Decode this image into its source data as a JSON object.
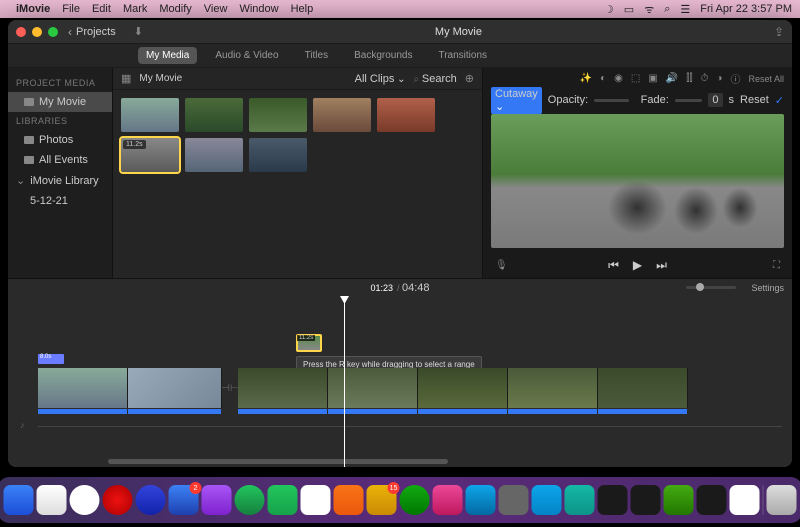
{
  "menubar": {
    "app": "iMovie",
    "items": [
      "File",
      "Edit",
      "Mark",
      "Modify",
      "View",
      "Window",
      "Help"
    ],
    "clock": "Fri Apr 22  3:57 PM"
  },
  "titlebar": {
    "projects": "Projects",
    "title": "My Movie"
  },
  "tabs": [
    "My Media",
    "Audio & Video",
    "Titles",
    "Backgrounds",
    "Transitions"
  ],
  "active_tab": 0,
  "sidebar": {
    "project_media_hdr": "PROJECT MEDIA",
    "my_movie": "My Movie",
    "libraries_hdr": "LIBRARIES",
    "items": [
      "Photos",
      "All Events",
      "iMovie Library",
      "5-12-21"
    ]
  },
  "browser": {
    "title": "My Movie",
    "filter": "All Clips",
    "search_placeholder": "Search",
    "thumbs": [
      {
        "dur": "",
        "sel": false,
        "cls": "tg1"
      },
      {
        "dur": "",
        "sel": false,
        "cls": "tg2"
      },
      {
        "dur": "",
        "sel": false,
        "cls": "tg3"
      },
      {
        "dur": "",
        "sel": false,
        "cls": "tg4"
      },
      {
        "dur": "",
        "sel": false,
        "cls": "tg5"
      },
      {
        "dur": "11.2s",
        "sel": true,
        "cls": "tg6"
      },
      {
        "dur": "",
        "sel": false,
        "cls": "tg7"
      },
      {
        "dur": "",
        "sel": false,
        "cls": "tg8"
      }
    ]
  },
  "viewer": {
    "reset": "Reset All",
    "overlay_label": "Cutaway",
    "opacity_label": "Opacity:",
    "fade_label": "Fade:",
    "fade_value": "0",
    "fade_unit": "s",
    "reset_btn": "Reset"
  },
  "meta": {
    "current": "01:23",
    "duration": "04:48",
    "settings": "Settings"
  },
  "timeline": {
    "overlay_dur": "11.2s",
    "tooltip": "Press the R key while dragging to select a range",
    "marker": "8.0s",
    "clips": [
      {
        "w": 90,
        "cls": "tc1"
      },
      {
        "w": 94,
        "cls": "tc2"
      },
      {
        "gap": true
      },
      {
        "w": 90,
        "cls": "tc3"
      },
      {
        "w": 90,
        "cls": "tc4"
      },
      {
        "w": 90,
        "cls": "tc5"
      },
      {
        "w": 90,
        "cls": "tc6"
      },
      {
        "w": 90,
        "cls": "tc7"
      }
    ]
  },
  "dock": [
    {
      "bg": "linear-gradient(#3b82f6,#1d4ed8)",
      "badge": ""
    },
    {
      "bg": "linear-gradient(#fff,#ddd)",
      "badge": ""
    },
    {
      "bg": "#fff",
      "badge": "",
      "round": true
    },
    {
      "bg": "radial-gradient(circle,#e11,#a00)",
      "badge": "",
      "round": true
    },
    {
      "bg": "linear-gradient(#34d,#12a)",
      "badge": "",
      "round": true
    },
    {
      "bg": "linear-gradient(#3b82f6,#1e40af)",
      "badge": "2"
    },
    {
      "bg": "linear-gradient(#a855f7,#7e22ce)",
      "badge": ""
    },
    {
      "bg": "linear-gradient(#22c55e,#15803d)",
      "badge": "",
      "round": true
    },
    {
      "bg": "linear-gradient(#22c55e,#16a34a)",
      "badge": ""
    },
    {
      "bg": "#fff",
      "badge": ""
    },
    {
      "bg": "linear-gradient(#f97316,#ea580c)",
      "badge": ""
    },
    {
      "bg": "linear-gradient(#eab308,#ca8a04)",
      "badge": "15"
    },
    {
      "bg": "linear-gradient(#1a1,#070)",
      "badge": "",
      "round": true
    },
    {
      "bg": "linear-gradient(#ec4899,#be185d)",
      "badge": ""
    },
    {
      "bg": "linear-gradient(#0ea5e9,#0369a1)",
      "badge": ""
    },
    {
      "bg": "#666",
      "badge": ""
    },
    {
      "bg": "linear-gradient(#0ea5e9,#0284c7)",
      "badge": ""
    },
    {
      "bg": "linear-gradient(#14b8a6,#0d9488)",
      "badge": ""
    },
    {
      "bg": "#1a1a1a",
      "badge": ""
    },
    {
      "bg": "#1a1a1a",
      "badge": ""
    },
    {
      "bg": "linear-gradient(#4a1,#270)",
      "badge": ""
    },
    {
      "bg": "#1a1a1a",
      "badge": ""
    },
    {
      "bg": "#fff",
      "badge": ""
    },
    {
      "sep": true
    },
    {
      "bg": "linear-gradient(#ddd,#aaa)",
      "badge": ""
    }
  ]
}
